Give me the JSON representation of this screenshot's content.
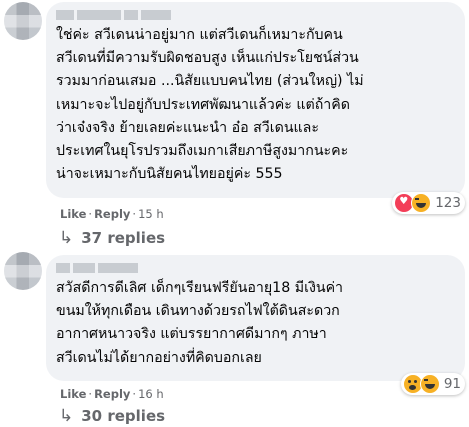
{
  "comments": [
    {
      "text": "ใช่ค่ะ สวีเดนน่าอยู่มาก แต่สวีเดนก็เหมาะกับคน\nสวีเดนที่มีความรับผิดชอบสูง เห็นแก่ประโยชน์ส่วน\nรวมมาก่อนเสมอ ...นิสัยแบบคนไทย (ส่วนใหญ่) ไม่\nเหมาะจะไปอยู่กับประเทศพัฒนาแล้วค่ะ แต่ถ้าคิด\nว่าเจ๋งจริง ย้ายเลยค่ะแนะนำ อ๋อ สวีเดนและ\nประเทศในยุโรปรวมถึงเมกาเสียภาษีสูงมากนะคะ\nน่าจะเหมาะกับนิสัยคนไทยอยู่ค่ะ 555",
      "reactions": {
        "icons": [
          "heart-icon",
          "haha-icon"
        ],
        "count": "123"
      },
      "like": "Like",
      "reply": "Reply",
      "time": "15 h",
      "replies": "37 replies"
    },
    {
      "text": "สวัสดีการดีเลิศ เด็กๆเรียนฟรียันอายุ18 มีเงินค่า\nขนมให้ทุกเดือน เดินทางด้วยรถไฟใต้ดินสะดวก\nอากาศหนาวจริง แต่บรรยากาศดีมากๆ ภาษา\nสวีเดนไม่ได้ยากอย่างที่คิดบอกเลย",
      "reactions": {
        "icons": [
          "wow-icon",
          "haha-icon"
        ],
        "count": "91"
      },
      "like": "Like",
      "reply": "Reply",
      "time": "16 h",
      "replies": "30 replies"
    }
  ],
  "colors": {
    "bubble": "#f0f2f5",
    "meta": "#65676b",
    "heart": "#f33e58",
    "emoji": "#f7b125"
  }
}
